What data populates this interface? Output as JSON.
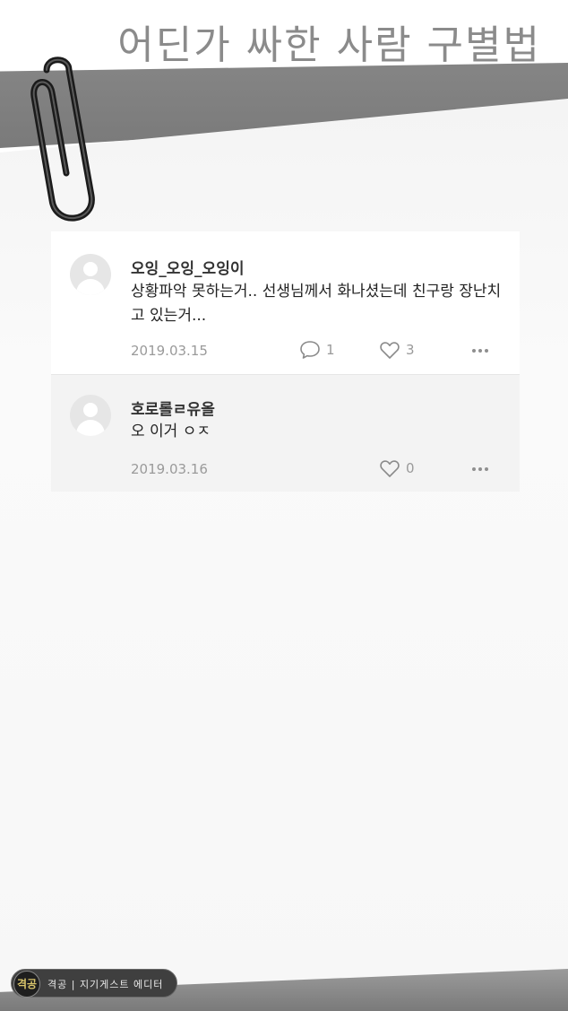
{
  "page_title": "어딘가 싸한 사람 구별법",
  "comments": [
    {
      "author": "오잉_오잉_오잉이",
      "text": "상황파악 못하는거.. 선생님께서 화나셨는데 친구랑 장난치고 있는거...",
      "date": "2019.03.15",
      "reply_count": "1",
      "like_count": "3"
    },
    {
      "author": "호로롤ㄹ유올",
      "text": "오 이거 ㅇㅈ",
      "date": "2019.03.16",
      "like_count": "0"
    }
  ],
  "watermark": {
    "logo": "격공",
    "text": "격공 | 지기게스트 에디터"
  },
  "icons": {
    "reply": "speech-bubble-icon",
    "like": "heart-icon",
    "more": "ellipsis-icon",
    "avatar": "default-avatar-icon",
    "clip": "paperclip-icon"
  }
}
